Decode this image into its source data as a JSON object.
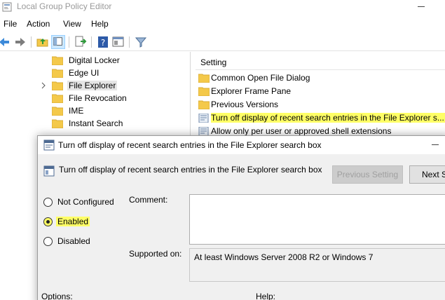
{
  "window": {
    "title": "Local Group Policy Editor"
  },
  "menu": {
    "items": [
      "File",
      "Action",
      "View",
      "Help"
    ]
  },
  "tree": {
    "items": [
      {
        "label": "Digital Locker"
      },
      {
        "label": "Edge UI"
      },
      {
        "label": "File Explorer"
      },
      {
        "label": "File Revocation"
      },
      {
        "label": "IME"
      },
      {
        "label": "Instant Search"
      }
    ]
  },
  "right_pane": {
    "column_header": "Setting",
    "items": [
      {
        "label": "Common Open File Dialog",
        "icon": "folder-icon"
      },
      {
        "label": "Explorer Frame Pane",
        "icon": "folder-icon"
      },
      {
        "label": "Previous Versions",
        "icon": "folder-icon"
      },
      {
        "label": "Turn off display of recent search entries in the File Explorer s...",
        "icon": "policy-setting-icon"
      },
      {
        "label": "Allow only per user or approved shell extensions",
        "icon": "policy-setting-icon"
      }
    ]
  },
  "dialog": {
    "title": "Turn off display of recent search entries in the File Explorer search box",
    "header": "Turn off display of recent search entries in the File Explorer search box",
    "previous_button": "Previous Setting",
    "next_button": "Next S",
    "radios": [
      "Not Configured",
      "Enabled",
      "Disabled"
    ],
    "selected_radio": "Enabled",
    "comment_label": "Comment:",
    "comment_value": "",
    "supported_label": "Supported on:",
    "supported_value": "At least Windows Server 2008 R2 or Windows 7",
    "options_label": "Options:",
    "help_label": "Help:"
  },
  "colors": {
    "highlight": "#ffff66",
    "folder": "#f4c94a",
    "selection": "#cce8ff"
  }
}
